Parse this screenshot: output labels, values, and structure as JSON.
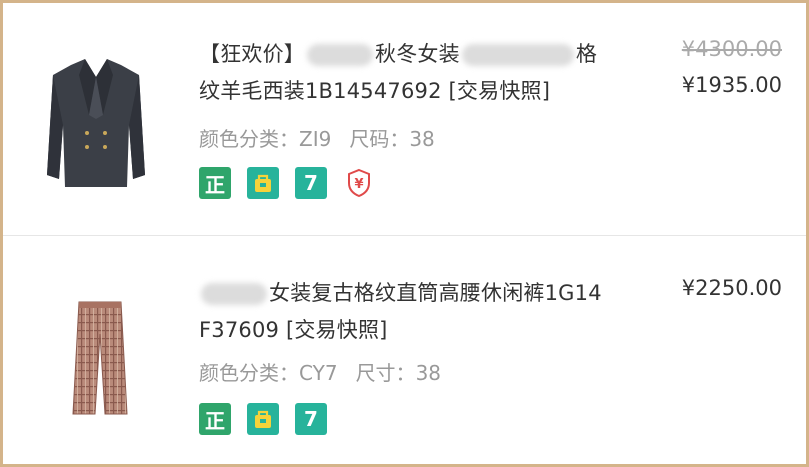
{
  "items": [
    {
      "title_prefix": "【狂欢价】",
      "title_mid": "秋冬女装",
      "title_end": "格",
      "title_line2": "纹羊毛西装1B14547692 [交易快照]",
      "sku_color_label": "颜色分类：",
      "sku_color_value": "ZI9",
      "sku_size_label": "尺码：",
      "sku_size_value": "38",
      "original_price": "¥4300.00",
      "price": "¥1935.00",
      "badges": [
        "正",
        "bag-icon",
        "7",
        "shield-yen-icon"
      ]
    },
    {
      "title_line1": "女装复古格纹直筒高腰休闲裤1G14",
      "title_line2": "F37609 [交易快照]",
      "sku_color_label": "颜色分类：",
      "sku_color_value": "CY7",
      "sku_size_label": "尺寸：",
      "sku_size_value": "38",
      "price": "¥2250.00",
      "badges": [
        "正",
        "bag-icon",
        "7"
      ]
    }
  ],
  "colors": {
    "frame": "#d4b48a",
    "badge_green": "#2fa56b",
    "badge_teal": "#27b39b",
    "shield_red": "#e04a4a",
    "muted_text": "#999999"
  }
}
